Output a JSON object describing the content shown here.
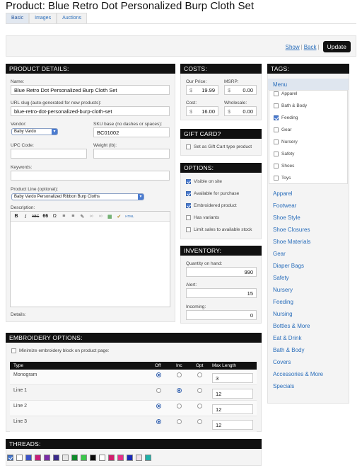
{
  "page_title": "Product: Blue Retro Dot Personalized Burp Cloth Set",
  "tabs": [
    "Basic",
    "Images",
    "Auctions"
  ],
  "actions": {
    "show": "Show",
    "back": "Back",
    "update": "Update"
  },
  "product_details": {
    "heading": "PRODUCT DETAILS:",
    "name_label": "Name:",
    "name_value": "Blue Retro Dot Personalized Burp Cloth Set",
    "slug_label": "URL slug (auto-generated for new products):",
    "slug_value": "blue-retro-dot-personalized-burp-cloth-set",
    "vendor_label": "Vendor:",
    "vendor_value": "Baby Vardo",
    "sku_label": "SKU base (no dashes or spaces):",
    "sku_value": "BC01002",
    "upc_label": "UPC Code:",
    "weight_label": "Weight (lb):",
    "keywords_label": "Keywords:",
    "line_label": "Product Line (optional):",
    "line_value": "Baby Vardo Personalized Ribbon Burp Cloths",
    "description_label": "Description:",
    "details_label": "Details:"
  },
  "costs": {
    "heading": "COSTS:",
    "our_price_label": "Our Price:",
    "our_price": "19.99",
    "msrp_label": "MSRP:",
    "msrp": "0.00",
    "cost_label": "Cost:",
    "cost": "16.00",
    "wholesale_label": "Wholesale:",
    "wholesale": "0.00",
    "currency": "$"
  },
  "gift_card": {
    "heading": "GIFT CARD?",
    "option": "Set as Gift Cart type product",
    "checked": false
  },
  "options": {
    "heading": "OPTIONS:",
    "items": [
      {
        "label": "Visible on site",
        "checked": true
      },
      {
        "label": "Available for purchase",
        "checked": true
      },
      {
        "label": "Embroidered product",
        "checked": true
      },
      {
        "label": "Has variants",
        "checked": false
      },
      {
        "label": "Limit sales to available stock",
        "checked": false
      }
    ]
  },
  "inventory": {
    "heading": "INVENTORY:",
    "on_hand_label": "Quantity on hand:",
    "on_hand": "990",
    "alert_label": "Alert:",
    "alert": "15",
    "incoming_label": "Incoming:",
    "incoming": "0"
  },
  "tags": {
    "heading": "TAGS:",
    "menu_label": "Menu",
    "menu_items": [
      {
        "label": "Apparel",
        "checked": false
      },
      {
        "label": "Bath & Body",
        "checked": false
      },
      {
        "label": "Feeding",
        "checked": true
      },
      {
        "label": "Gear",
        "checked": false
      },
      {
        "label": "Nursery",
        "checked": false
      },
      {
        "label": "Safety",
        "checked": false
      },
      {
        "label": "Shoes",
        "checked": false
      },
      {
        "label": "Toys",
        "checked": false
      }
    ],
    "categories": [
      "Apparel",
      "Footwear",
      "Shoe Style",
      "Shoe Closures",
      "Shoe Materials",
      "Gear",
      "Diaper Bags",
      "Safety",
      "Nursery",
      "Feeding",
      "Nursing",
      "Bottles & More",
      "Eat & Drink",
      "Bath & Body",
      "Covers",
      "Accessories & More",
      "Specials"
    ]
  },
  "embroidery": {
    "heading": "EMBROIDERY OPTIONS:",
    "minimize_label": "Minimize embroidery block on product page:",
    "columns": [
      "Type",
      "Off",
      "Inc",
      "Opt",
      "Max Length"
    ],
    "rows": [
      {
        "type": "Monogram",
        "selected": "off",
        "max": "3"
      },
      {
        "type": "Line 1",
        "selected": "inc",
        "max": "12"
      },
      {
        "type": "Line 2",
        "selected": "off",
        "max": "12"
      },
      {
        "type": "Line 3",
        "selected": "off",
        "max": "12"
      }
    ]
  },
  "threads": {
    "heading": "THREADS:",
    "colors": [
      "#2aa0d8",
      "#ffffff",
      "#3b52c8",
      "#c81e7a",
      "#7a2aa8",
      "#3a2a8a",
      "#e6e6e6",
      "#0e8a2a",
      "#3ac84a",
      "#0a0a0a",
      "#ffffff",
      "#d21e6e",
      "#e6308a",
      "#1a2ab8",
      "#f0e0e8",
      "#20b0a8"
    ]
  },
  "editor_tools": [
    "B",
    "I",
    "ABC",
    "66",
    "Ω",
    "≡",
    "≡",
    "✎",
    "∞",
    "∞",
    "▦",
    "✔",
    "HTML"
  ]
}
